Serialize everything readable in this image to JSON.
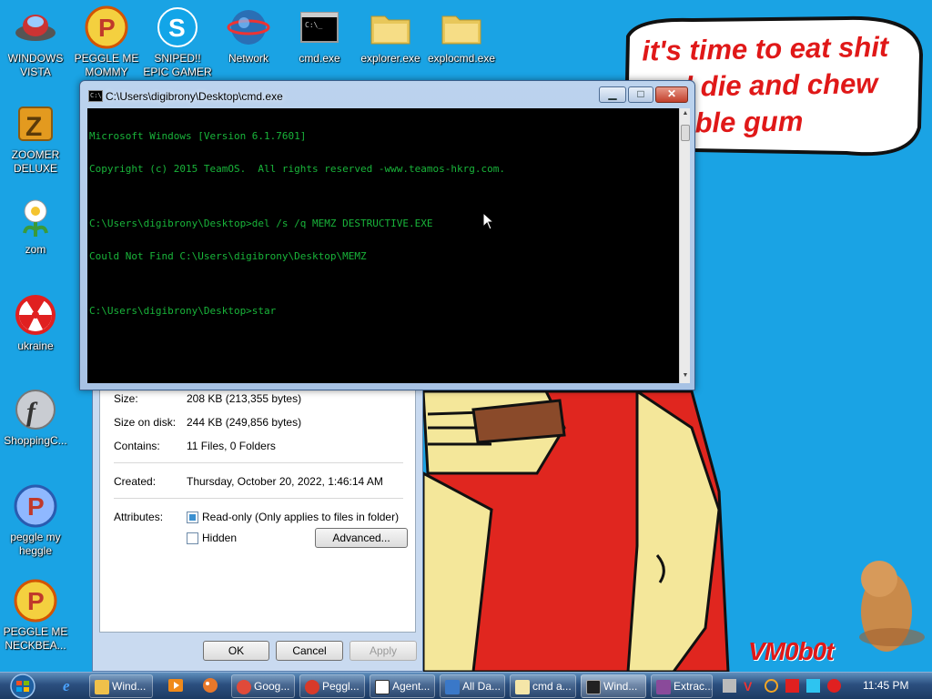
{
  "wallpaper": {
    "bubble_lines": [
      "it's time to eat shit",
      "and die and chew",
      "bubble gum"
    ],
    "watermark": "VM0b0t"
  },
  "desktop_icons": [
    {
      "label": "WINDOWS VISTA",
      "icon": "ufo-icon"
    },
    {
      "label": "PEGGLE ME MOMMY",
      "icon": "peggle-icon"
    },
    {
      "label": "SNIPED!! EPIC GAMER 360...",
      "icon": "skype-icon"
    },
    {
      "label": "Network",
      "icon": "network-icon"
    },
    {
      "label": "cmd.exe",
      "icon": "cmd-icon"
    },
    {
      "label": "explorer.exe",
      "icon": "folder-icon"
    },
    {
      "label": "explocmd.exe",
      "icon": "folder-icon"
    },
    {
      "label": "ZOOMER DELUXE",
      "icon": "zuma-icon"
    },
    {
      "label": "zom",
      "icon": "plant-icon"
    },
    {
      "label": "ukraine",
      "icon": "radiation-icon"
    },
    {
      "label": "ShoppingC...",
      "icon": "flash-icon"
    },
    {
      "label": "peggle my heggle",
      "icon": "peggle-icon"
    },
    {
      "label": "PEGGLE ME NECKBEA...",
      "icon": "peggle-icon"
    }
  ],
  "cmd_window": {
    "title": "C:\\Users\\digibrony\\Desktop\\cmd.exe",
    "lines": [
      "Microsoft Windows [Version 6.1.7601]",
      "Copyright (c) 2015 TeamOS.  All rights reserved -www.teamos-hkrg.com.",
      "",
      "C:\\Users\\digibrony\\Desktop>del /s /q MEMZ DESTRUCTIVE.EXE",
      "Could Not Find C:\\Users\\digibrony\\Desktop\\MEMZ",
      "",
      "C:\\Users\\digibrony\\Desktop>star"
    ],
    "buttons": {
      "minimize": "▁",
      "maximize": "□",
      "close": "✕"
    }
  },
  "properties": {
    "size_label": "Size:",
    "size_value": "208 KB (213,355 bytes)",
    "size_on_disk_label": "Size on disk:",
    "size_on_disk_value": "244 KB (249,856 bytes)",
    "contains_label": "Contains:",
    "contains_value": "11 Files, 0 Folders",
    "created_label": "Created:",
    "created_value": "Thursday, October 20, 2022, 1:46:14 AM",
    "attributes_label": "Attributes:",
    "readonly_label": "Read-only (Only applies to files in folder)",
    "hidden_label": "Hidden",
    "advanced_button": "Advanced...",
    "ok_button": "OK",
    "cancel_button": "Cancel",
    "apply_button": "Apply"
  },
  "taskbar": {
    "buttons": [
      {
        "label": "Wind...",
        "icon_color": "#f0c14a"
      },
      {
        "label": "Goog...",
        "icon_color": "#e04a3a"
      },
      {
        "label": "Peggl...",
        "icon_color": "#d83a2a"
      },
      {
        "label": "Agent...",
        "icon_color": "#ffffff"
      },
      {
        "label": "All Da...",
        "icon_color": "#3a78c8"
      },
      {
        "label": "cmd a...",
        "icon_color": "#f5e6a8"
      },
      {
        "label": "Wind...",
        "icon_color": "#222222"
      },
      {
        "label": "Extrac...",
        "icon_color": "#8a4a9a"
      }
    ],
    "clock": "11:45 PM"
  }
}
